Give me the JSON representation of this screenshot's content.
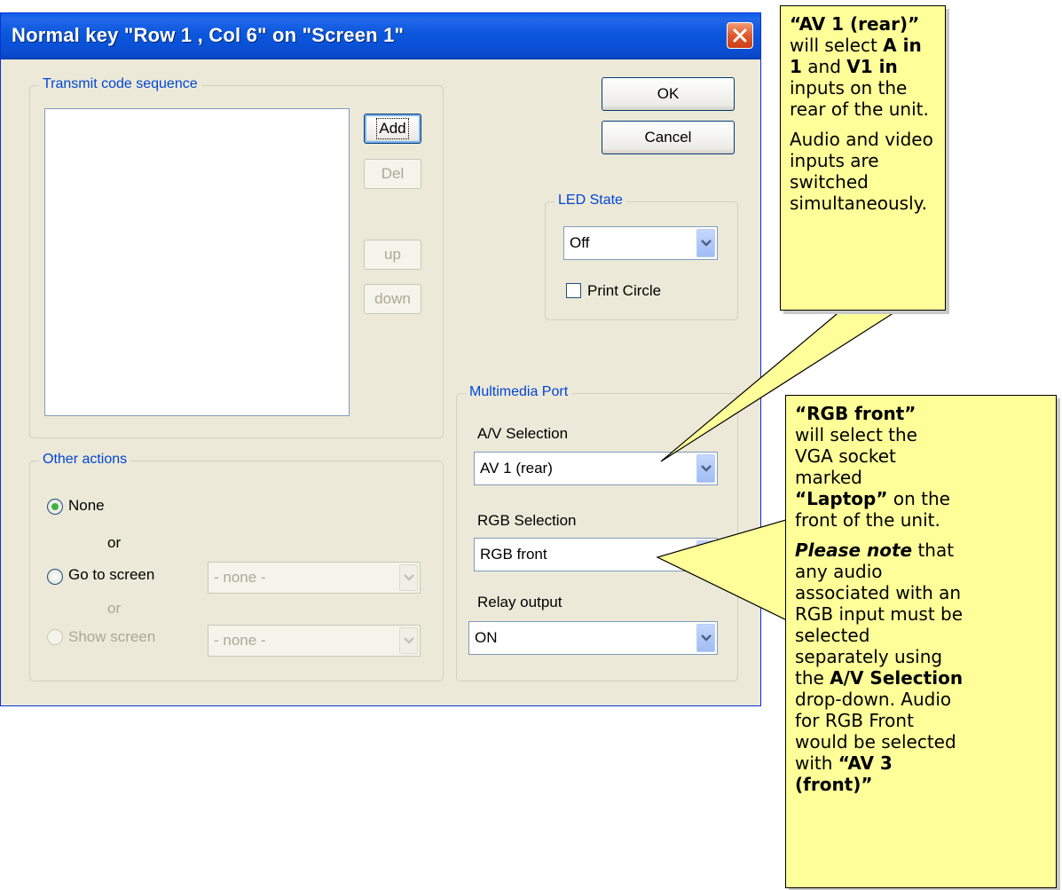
{
  "dialog": {
    "title": "Normal key \"Row 1 , Col 6\" on \"Screen 1\"",
    "buttons": {
      "ok": "OK",
      "cancel": "Cancel"
    },
    "transmit": {
      "legend": "Transmit code sequence",
      "add": "Add",
      "del": "Del",
      "up": "up",
      "down": "down"
    },
    "led": {
      "legend": "LED State",
      "value": "Off",
      "print_circle": "Print Circle"
    },
    "multimedia": {
      "legend": "Multimedia Port",
      "av_label": "A/V Selection",
      "av_value": "AV 1 (rear)",
      "rgb_label": "RGB Selection",
      "rgb_value": "RGB front",
      "relay_label": "Relay output",
      "relay_value": "ON"
    },
    "other": {
      "legend": "Other actions",
      "none": "None",
      "or1": "or",
      "goto": "Go to screen",
      "goto_value": "- none -",
      "or2": "or",
      "show": "Show screen",
      "show_value": "- none -"
    }
  },
  "callout_av": {
    "p1_a": "“AV 1 (rear)”",
    "p1_b": " will select ",
    "p1_c": "A in 1",
    "p1_d": " and ",
    "p1_e": "V1 in",
    "p1_f": " inputs on the rear of the unit.",
    "p2": "Audio and video inputs are switched simultaneously."
  },
  "callout_rgb": {
    "p1_a": "“RGB front”",
    "p1_b": " will select the VGA socket marked ",
    "p1_c": "“Laptop”",
    "p1_d": " on the front of the unit.",
    "p2_a": "Please note",
    "p2_b": " that any audio associated with an RGB input must be selected separately using the ",
    "p2_c": "A/V Selection",
    "p2_d": " drop-down. Audio for RGB Front would be selected with ",
    "p2_e": "“AV 3 (front)”"
  },
  "colors": {
    "title_bar": "#0a55dd",
    "callout_bg": "#ffff99",
    "legend_text": "#0046d5"
  }
}
